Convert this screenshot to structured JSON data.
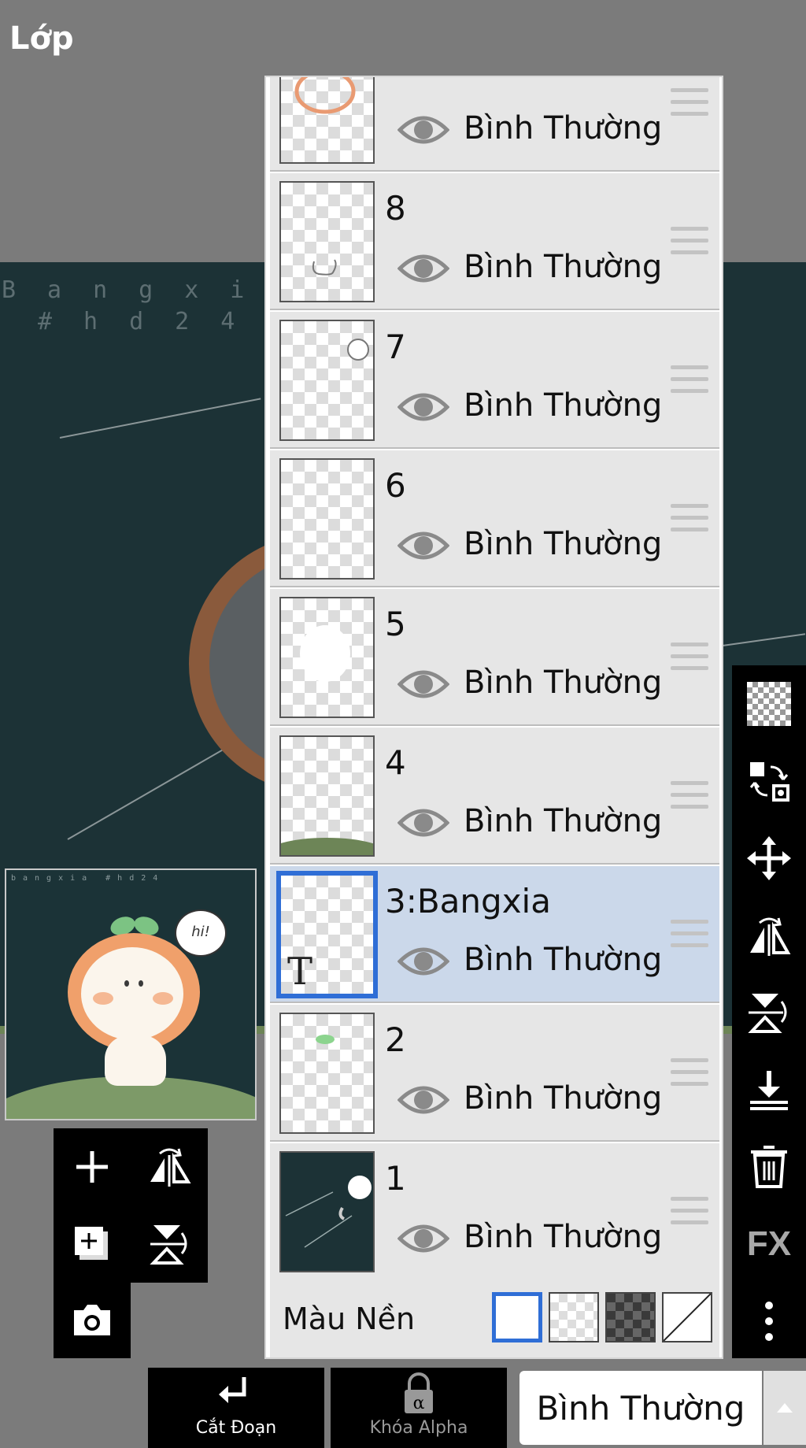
{
  "app": {
    "title": "Lớp"
  },
  "canvas": {
    "watermark_line1": "Bangxi",
    "watermark_line2": "#hd24",
    "thumbnail_watermark": "bangxia #hd24",
    "bubble_text": "hi!"
  },
  "layers": [
    {
      "name": "",
      "blend": "Bình Thường",
      "selected": false
    },
    {
      "name": "8",
      "blend": "Bình Thường",
      "selected": false
    },
    {
      "name": "7",
      "blend": "Bình Thường",
      "selected": false
    },
    {
      "name": "6",
      "blend": "Bình Thường",
      "selected": false
    },
    {
      "name": "5",
      "blend": "Bình Thường",
      "selected": false
    },
    {
      "name": "4",
      "blend": "Bình Thường",
      "selected": false
    },
    {
      "name": "3:Bangxia",
      "blend": "Bình Thường",
      "selected": true
    },
    {
      "name": "2",
      "blend": "Bình Thường",
      "selected": false
    },
    {
      "name": "1",
      "blend": "Bình Thường",
      "selected": false
    }
  ],
  "background_row": {
    "label": "Màu Nền",
    "options": [
      "white",
      "transparent-light",
      "transparent-dark",
      "none"
    ],
    "selected": "white"
  },
  "left_tools": [
    "add-layer-icon",
    "flip-horizontal-icon",
    "duplicate-layer-icon",
    "flip-vertical-icon",
    "camera-icon"
  ],
  "right_toolbar": {
    "items": [
      "transparency-icon",
      "swap-icon",
      "move-icon",
      "flip-horizontal-icon",
      "flip-vertical-icon",
      "merge-down-icon",
      "trash-icon",
      "fx-icon",
      "more-icon"
    ],
    "fx_label": "FX"
  },
  "bottom_bar": {
    "clip_label": "Cắt Đoạn",
    "alpha_lock_label": "Khóa Alpha",
    "alpha_symbol": "α",
    "blend_mode": "Bình Thường"
  },
  "colors": {
    "selection": "#2f6ed6",
    "selected_row": "#cbd8ea",
    "toolbar": "#000000",
    "background": "#7b7b7b"
  }
}
